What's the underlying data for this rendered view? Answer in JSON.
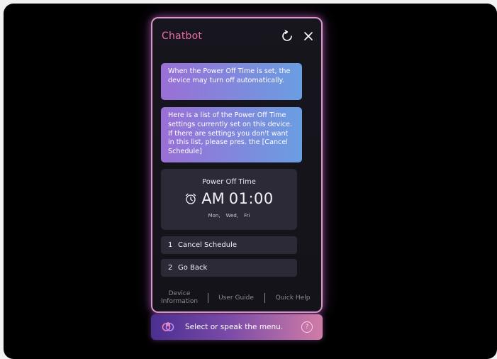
{
  "chatbot": {
    "title": "Chatbot",
    "refresh_icon": "refresh-icon",
    "close_icon": "close-icon",
    "messages": [
      "When the Power Off Time is set, the device may turn off automatically.",
      "Here is a list of the Power Off Time settings currently set on this device. If there are settings you don't want in this list, please pres. the [Cancel Schedule]"
    ],
    "power_off_card": {
      "title": "Power Off Time",
      "alarm_icon": "alarm-clock-icon",
      "ampm": "AM",
      "time": "01:00",
      "days": [
        "Mon,",
        "Wed,",
        "Fri"
      ]
    },
    "options": [
      {
        "number": "1",
        "label": "Cancel Schedule"
      },
      {
        "number": "2",
        "label": "Go Back"
      }
    ],
    "footer_links": [
      "Device Information",
      "User Guide",
      "Quick Help"
    ]
  },
  "voice_bar": {
    "logo_icon": "voice-assistant-logo-icon",
    "prompt": "Select or speak the menu.",
    "help_label": "?"
  },
  "colors": {
    "title_pink": "#ef6da5",
    "panel_border": "#d89ac9",
    "bubble_start": "#9a6fd6",
    "bubble_end": "#6a9ee2",
    "card_bg": "#2b2a36"
  }
}
